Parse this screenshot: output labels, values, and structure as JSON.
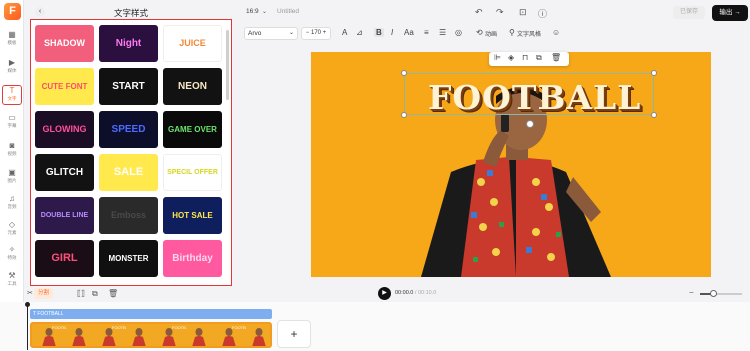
{
  "app": {
    "logo": "F"
  },
  "rail": {
    "items": [
      {
        "icon": "layout-icon",
        "glyph": "▦",
        "label": "模板"
      },
      {
        "icon": "media-icon",
        "glyph": "▶",
        "label": "媒体"
      },
      {
        "icon": "text-icon",
        "glyph": "T",
        "label": "文字",
        "active": true
      },
      {
        "icon": "subtitle-icon",
        "glyph": "▭",
        "label": "字幕"
      },
      {
        "icon": "video-icon",
        "glyph": "◙",
        "label": "视频"
      },
      {
        "icon": "image-icon",
        "glyph": "▣",
        "label": "图片"
      },
      {
        "icon": "music-icon",
        "glyph": "♫",
        "label": "音频"
      },
      {
        "icon": "element-icon",
        "glyph": "◇",
        "label": "元素"
      },
      {
        "icon": "effect-icon",
        "glyph": "✧",
        "label": "特效"
      },
      {
        "icon": "tools-icon",
        "glyph": "⚒",
        "label": "工具"
      }
    ]
  },
  "panel": {
    "title": "文字样式",
    "back": "‹",
    "styles": [
      {
        "text": "SHADOW",
        "bg": "#f25f7c",
        "color": "#ffffff"
      },
      {
        "text": "Night",
        "bg": "#2a0f3f",
        "color": "#ff7af0"
      },
      {
        "text": "JUICE",
        "bg": "#ffffff",
        "color": "#f08a3a"
      },
      {
        "text": "CUTE FONT",
        "bg": "#ffe94d",
        "color": "#ff4d6d"
      },
      {
        "text": "START",
        "bg": "#111111",
        "color": "#ffffff"
      },
      {
        "text": "NEON",
        "bg": "#121212",
        "color": "#f5e9c5"
      },
      {
        "text": "GLOWING",
        "bg": "#1a0d24",
        "color": "#ff4f9b"
      },
      {
        "text": "SPEED",
        "bg": "#0d0f2a",
        "color": "#4a6bff"
      },
      {
        "text": "GAME OVER",
        "bg": "#0a0a0a",
        "color": "#6de36d"
      },
      {
        "text": "GLITCH",
        "bg": "#121212",
        "color": "#ffffff"
      },
      {
        "text": "SALE",
        "bg": "#ffe94d",
        "color": "#ffffff"
      },
      {
        "text": "SPECIL OFFER",
        "bg": "#ffffff",
        "color": "#d7d722"
      },
      {
        "text": "DOUBLE LINE",
        "bg": "#2d1a4a",
        "color": "#b88aff"
      },
      {
        "text": "Emboss",
        "bg": "#2a2a2a",
        "color": "#4a4a4a"
      },
      {
        "text": "HOT SALE",
        "bg": "#0f1e5c",
        "color": "#ffe94d"
      },
      {
        "text": "GIRL",
        "bg": "#1a0d16",
        "color": "#ff4f7b"
      },
      {
        "text": "MONSTER",
        "bg": "#101010",
        "color": "#ffffff"
      },
      {
        "text": "Birthday",
        "bg": "#ff5aa0",
        "color": "#ffd6ec"
      }
    ]
  },
  "topbar": {
    "ratio": "16:9",
    "doc_title": "Untitled",
    "save": "已保存",
    "export": "输出"
  },
  "format": {
    "font": "Arvo",
    "size": "170",
    "animation": "动画",
    "text_style": "文字风格"
  },
  "canvas": {
    "text": "FOOTBALL",
    "bg_color": "#f7a818"
  },
  "playback": {
    "split": "分割",
    "current": "00:00.0",
    "duration": "/ 00:10.0",
    "zoom": 0.3
  },
  "timeline": {
    "text_track": "FOOTBALL",
    "frame_label": "FOOTBALL",
    "add": "+"
  }
}
